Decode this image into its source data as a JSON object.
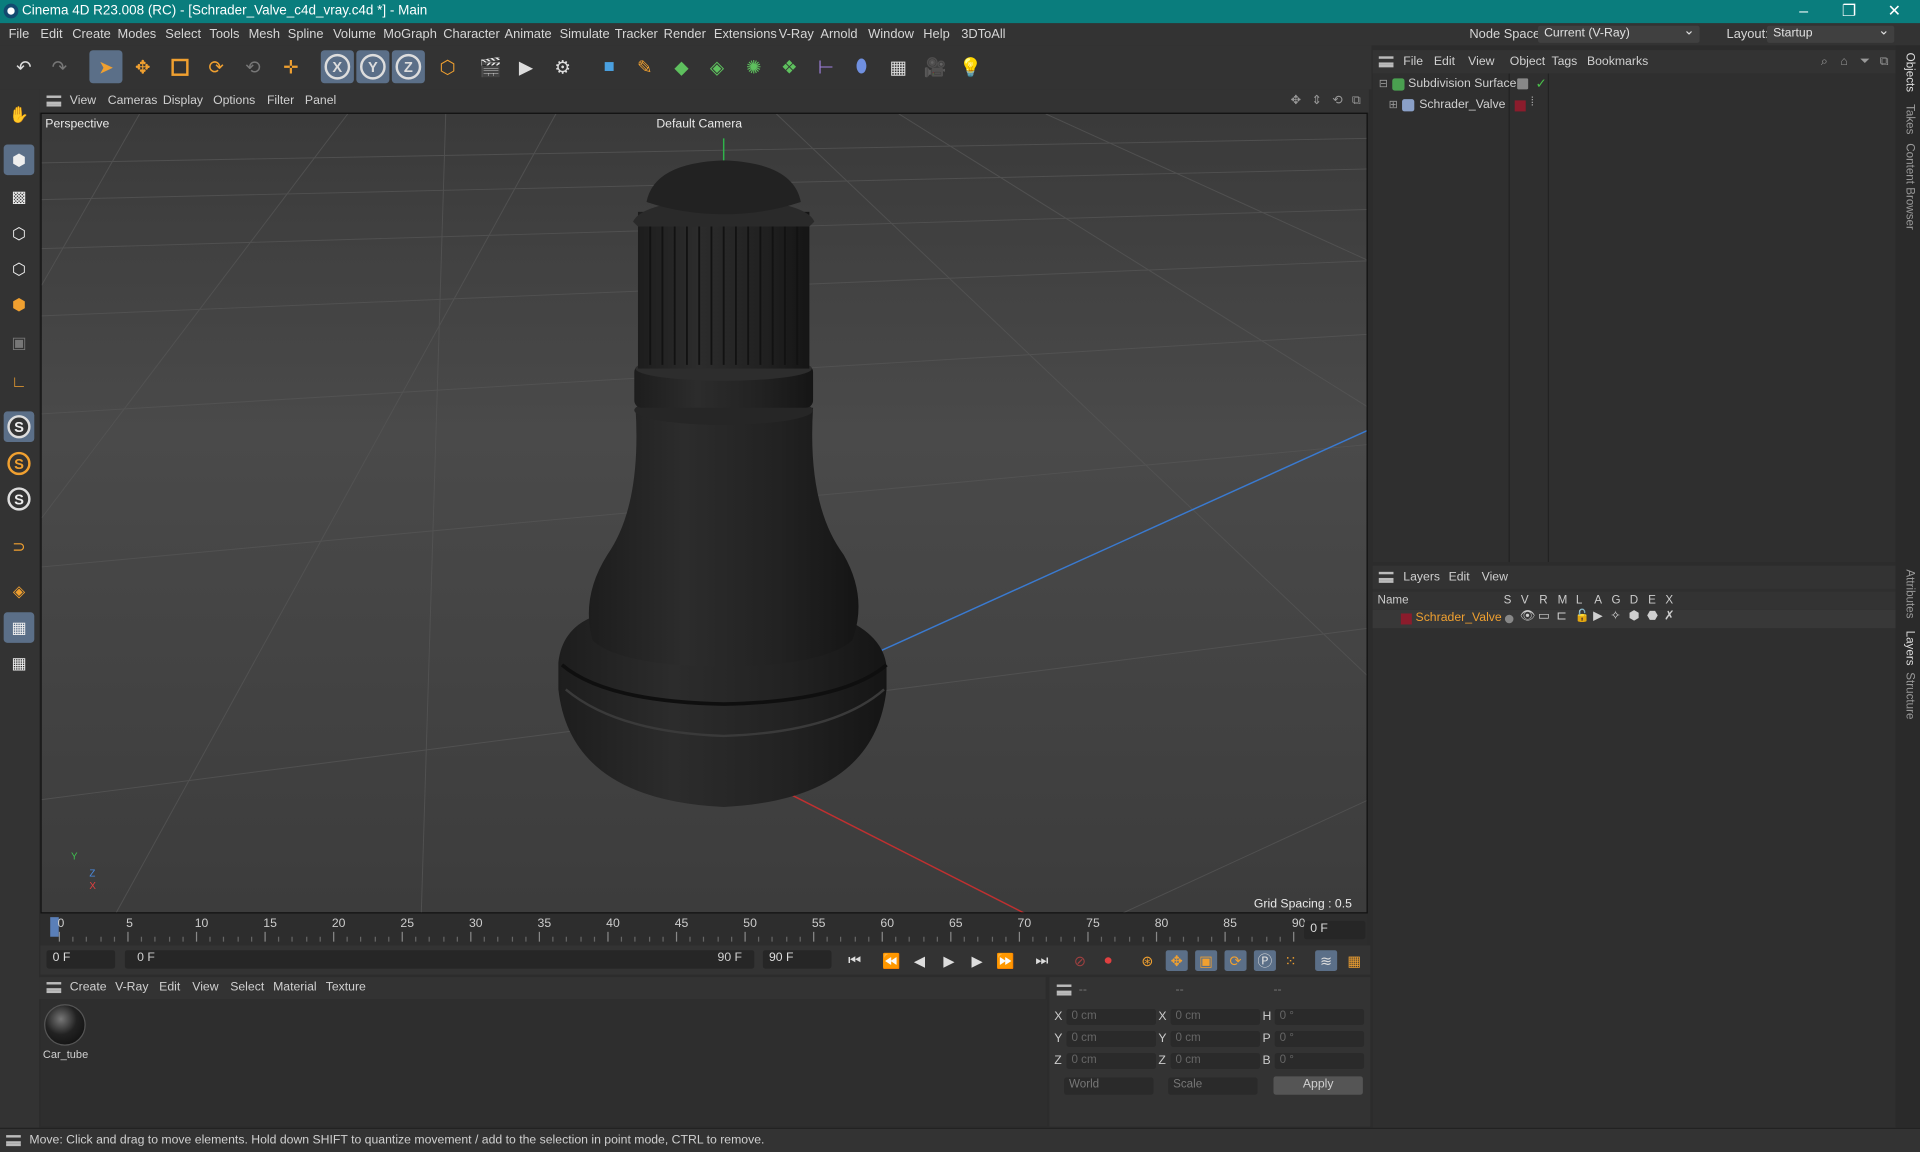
{
  "window": {
    "title": "Cinema 4D R23.008 (RC) - [Schrader_Valve_c4d_vray.c4d *] - Main",
    "controls": [
      "–",
      "❐",
      "✕"
    ]
  },
  "menubar": {
    "items": [
      "File",
      "Edit",
      "Create",
      "Modes",
      "Select",
      "Tools",
      "Mesh",
      "Spline",
      "Volume",
      "MoGraph",
      "Character",
      "Animate",
      "Simulate",
      "Tracker",
      "Render",
      "Extensions",
      "V-Ray",
      "Arnold",
      "Window",
      "Help",
      "3DToAll"
    ],
    "node_space_label": "Node Space:",
    "node_space_value": "Current (V-Ray)",
    "layout_label": "Layout:",
    "layout_value": "Startup"
  },
  "toolbar": {
    "axis_x": "X",
    "axis_y": "Y",
    "axis_z": "Z"
  },
  "viewport": {
    "menu": [
      "View",
      "Cameras",
      "Display",
      "Options",
      "Filter",
      "Panel"
    ],
    "name": "Perspective",
    "camera": "Default Camera",
    "grid_spacing": "Grid Spacing : 0.5 cm",
    "axis_y": "Y",
    "axis_z": "Z",
    "axis_x": "X"
  },
  "timeline": {
    "ticks": [
      "0",
      "5",
      "10",
      "15",
      "20",
      "25",
      "30",
      "35",
      "40",
      "45",
      "50",
      "55",
      "60",
      "65",
      "70",
      "75",
      "80",
      "85",
      "90"
    ],
    "current_frame": "0 F"
  },
  "playbar": {
    "start": "0 F",
    "range_start": "0 F",
    "range_end": "90 F",
    "end": "90 F"
  },
  "material_manager": {
    "menu": [
      "Create",
      "V-Ray",
      "Edit",
      "View",
      "Select",
      "Material",
      "Texture"
    ],
    "materials": [
      {
        "name": "Car_tube"
      }
    ]
  },
  "coordinates": {
    "headers": [
      "--",
      "--",
      "--"
    ],
    "rows": [
      {
        "l1": "X",
        "v1": "0 cm",
        "l2": "X",
        "v2": "0 cm",
        "l3": "H",
        "v3": "0 °"
      },
      {
        "l1": "Y",
        "v1": "0 cm",
        "l2": "Y",
        "v2": "0 cm",
        "l3": "P",
        "v3": "0 °"
      },
      {
        "l1": "Z",
        "v1": "0 cm",
        "l2": "Z",
        "v2": "0 cm",
        "l3": "B",
        "v3": "0 °"
      }
    ],
    "mode": "World",
    "size_mode": "Scale",
    "apply": "Apply"
  },
  "object_manager": {
    "menu": [
      "File",
      "Edit",
      "View",
      "Object",
      "Tags",
      "Bookmarks"
    ],
    "objects": [
      {
        "name": "Subdivision Surface"
      },
      {
        "name": "Schrader_Valve"
      }
    ]
  },
  "layer_manager": {
    "menu": [
      "Layers",
      "Edit",
      "View"
    ],
    "columns": [
      "Name",
      "S",
      "V",
      "R",
      "M",
      "L",
      "A",
      "G",
      "D",
      "E",
      "X"
    ],
    "layers": [
      {
        "name": "Schrader_Valve",
        "color": "#8b1c2c"
      }
    ]
  },
  "side_tabs": [
    "Objects",
    "Takes",
    "Content Browser",
    "Attributes",
    "Layers",
    "Structure"
  ],
  "status": "Move: Click and drag to move elements. Hold down SHIFT to quantize movement / add to the selection in point mode, CTRL to remove.",
  "colors": {
    "accent": "#f0a030",
    "title_bar": "#0a7d7d",
    "selection": "#5b6f88"
  }
}
